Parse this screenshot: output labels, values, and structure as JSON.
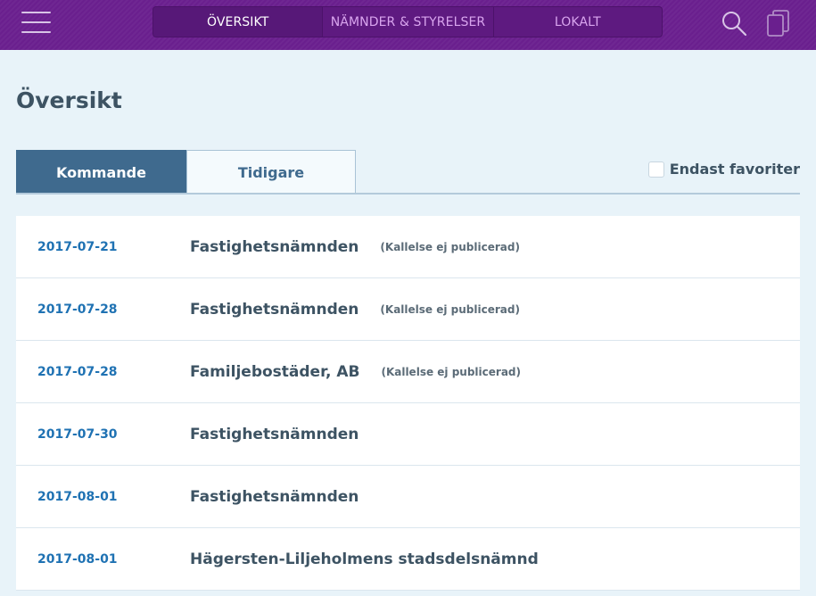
{
  "nav": {
    "tabs": [
      {
        "label": "ÖVERSIKT",
        "active": true
      },
      {
        "label": "NÄMNDER & STYRELSER",
        "active": false
      },
      {
        "label": "LOKALT",
        "active": false
      }
    ],
    "icons": {
      "menu": "hamburger-menu-icon",
      "search": "search-icon",
      "cards": "cards-icon"
    }
  },
  "page": {
    "title": "Översikt"
  },
  "tabs": {
    "upcoming": "Kommande",
    "previous": "Tidigare",
    "active": "upcoming"
  },
  "filter": {
    "favorites_label": "Endast favoriter",
    "checked": false
  },
  "meetings": [
    {
      "date": "2017-07-21",
      "name": "Fastighetsnämnden",
      "note": "(Kallelse ej publicerad)"
    },
    {
      "date": "2017-07-28",
      "name": "Fastighetsnämnden",
      "note": "(Kallelse ej publicerad)"
    },
    {
      "date": "2017-07-28",
      "name": "Familjebostäder, AB",
      "note": "(Kallelse ej publicerad)"
    },
    {
      "date": "2017-07-30",
      "name": "Fastighetsnämnden",
      "note": ""
    },
    {
      "date": "2017-08-01",
      "name": "Fastighetsnämnden",
      "note": ""
    },
    {
      "date": "2017-08-01",
      "name": "Hägersten-Liljeholmens stadsdelsnämnd",
      "note": ""
    }
  ],
  "colors": {
    "header": "#6a1f8e",
    "accent": "#3f6a8e",
    "date": "#1f72b3",
    "text": "#3d5363",
    "background": "#e8f3f9"
  }
}
